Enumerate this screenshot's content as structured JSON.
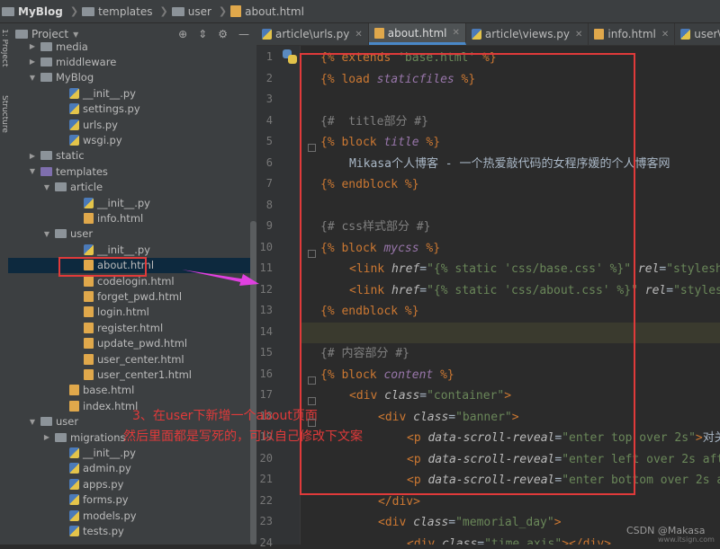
{
  "breadcrumb": [
    "MyBlog",
    "templates",
    "user",
    "about.html"
  ],
  "project_panel": {
    "label": "Project"
  },
  "left_strip_labels": [
    "1: Project",
    "Structure"
  ],
  "tree": [
    {
      "label": "media",
      "depth": 1,
      "kind": "folder",
      "arrow": "closed"
    },
    {
      "label": "middleware",
      "depth": 1,
      "kind": "folder",
      "arrow": "closed"
    },
    {
      "label": "MyBlog",
      "depth": 1,
      "kind": "pkg",
      "arrow": "open"
    },
    {
      "label": "__init__.py",
      "depth": 3,
      "kind": "py"
    },
    {
      "label": "settings.py",
      "depth": 3,
      "kind": "py"
    },
    {
      "label": "urls.py",
      "depth": 3,
      "kind": "py"
    },
    {
      "label": "wsgi.py",
      "depth": 3,
      "kind": "py"
    },
    {
      "label": "static",
      "depth": 1,
      "kind": "folder",
      "arrow": "closed"
    },
    {
      "label": "templates",
      "depth": 1,
      "kind": "tpl",
      "arrow": "open"
    },
    {
      "label": "article",
      "depth": 2,
      "kind": "folder",
      "arrow": "open"
    },
    {
      "label": "__init__.py",
      "depth": 4,
      "kind": "py"
    },
    {
      "label": "info.html",
      "depth": 4,
      "kind": "html"
    },
    {
      "label": "user",
      "depth": 2,
      "kind": "folder",
      "arrow": "open"
    },
    {
      "label": "__init__.py",
      "depth": 4,
      "kind": "py"
    },
    {
      "label": "about.html",
      "depth": 4,
      "kind": "html",
      "selected": true
    },
    {
      "label": "codelogin.html",
      "depth": 4,
      "kind": "html"
    },
    {
      "label": "forget_pwd.html",
      "depth": 4,
      "kind": "html"
    },
    {
      "label": "login.html",
      "depth": 4,
      "kind": "html"
    },
    {
      "label": "register.html",
      "depth": 4,
      "kind": "html"
    },
    {
      "label": "update_pwd.html",
      "depth": 4,
      "kind": "html"
    },
    {
      "label": "user_center.html",
      "depth": 4,
      "kind": "html"
    },
    {
      "label": "user_center1.html",
      "depth": 4,
      "kind": "html"
    },
    {
      "label": "base.html",
      "depth": 3,
      "kind": "html"
    },
    {
      "label": "index.html",
      "depth": 3,
      "kind": "html"
    },
    {
      "label": "user",
      "depth": 1,
      "kind": "pkg",
      "arrow": "open"
    },
    {
      "label": "migrations",
      "depth": 2,
      "kind": "pkg",
      "arrow": "closed"
    },
    {
      "label": "__init__.py",
      "depth": 3,
      "kind": "py"
    },
    {
      "label": "admin.py",
      "depth": 3,
      "kind": "py"
    },
    {
      "label": "apps.py",
      "depth": 3,
      "kind": "py"
    },
    {
      "label": "forms.py",
      "depth": 3,
      "kind": "py"
    },
    {
      "label": "models.py",
      "depth": 3,
      "kind": "py"
    },
    {
      "label": "tests.py",
      "depth": 3,
      "kind": "py"
    }
  ],
  "tabs": [
    {
      "label": "article\\urls.py",
      "kind": "py",
      "active": false
    },
    {
      "label": "about.html",
      "kind": "html",
      "active": true
    },
    {
      "label": "article\\views.py",
      "kind": "py",
      "active": false
    },
    {
      "label": "info.html",
      "kind": "html",
      "active": false
    },
    {
      "label": "user\\views.py",
      "kind": "py",
      "active": false
    }
  ],
  "code_lines": [
    {
      "n": 1,
      "indent": 0,
      "parts": [
        [
          "t",
          "{% extends "
        ],
        [
          "s",
          "'base.html'"
        ],
        [
          "t",
          " %}"
        ]
      ]
    },
    {
      "n": 2,
      "indent": 0,
      "parts": [
        [
          "t",
          "{% load "
        ],
        [
          "i",
          "staticfiles"
        ],
        [
          "t",
          " %}"
        ]
      ]
    },
    {
      "n": 3,
      "indent": 0,
      "parts": []
    },
    {
      "n": 4,
      "indent": 0,
      "parts": [
        [
          "c",
          "{#  title部分 #}"
        ]
      ]
    },
    {
      "n": 5,
      "indent": 0,
      "parts": [
        [
          "t",
          "{% block "
        ],
        [
          "i",
          "title"
        ],
        [
          "t",
          " %}"
        ]
      ]
    },
    {
      "n": 6,
      "indent": 1,
      "parts": [
        [
          "p",
          "Mikasa个人博客 - 一个热爱敲代码的女程序媛的个人博客网"
        ]
      ]
    },
    {
      "n": 7,
      "indent": 0,
      "parts": [
        [
          "t",
          "{% endblock "
        ],
        [
          "t",
          "%}"
        ]
      ]
    },
    {
      "n": 8,
      "indent": 0,
      "parts": []
    },
    {
      "n": 9,
      "indent": 0,
      "parts": [
        [
          "c",
          "{# css样式部分 #}"
        ]
      ]
    },
    {
      "n": 10,
      "indent": 0,
      "parts": [
        [
          "t",
          "{% block "
        ],
        [
          "i",
          "mycss"
        ],
        [
          "t",
          " %}"
        ]
      ]
    },
    {
      "n": 11,
      "indent": 1,
      "parts": [
        [
          "t",
          "<link "
        ],
        [
          "a",
          "href"
        ],
        [
          "p",
          "="
        ],
        [
          "s",
          "\"{% static 'css/base.css' %}\""
        ],
        [
          "p",
          " "
        ],
        [
          "a",
          "rel"
        ],
        [
          "p",
          "="
        ],
        [
          "s",
          "\"stylesh"
        ]
      ]
    },
    {
      "n": 12,
      "indent": 1,
      "parts": [
        [
          "t",
          "<link "
        ],
        [
          "a",
          "href"
        ],
        [
          "p",
          "="
        ],
        [
          "s",
          "\"{% static 'css/about.css' %}\""
        ],
        [
          "p",
          " "
        ],
        [
          "a",
          "rel"
        ],
        [
          "p",
          "="
        ],
        [
          "s",
          "\"styles"
        ]
      ]
    },
    {
      "n": 13,
      "indent": 0,
      "parts": [
        [
          "t",
          "{% endblock "
        ],
        [
          "t",
          "%}"
        ]
      ]
    },
    {
      "n": 14,
      "indent": 0,
      "parts": [],
      "highlight": true
    },
    {
      "n": 15,
      "indent": 0,
      "parts": [
        [
          "c",
          "{# 内容部分 #}"
        ]
      ]
    },
    {
      "n": 16,
      "indent": 0,
      "parts": [
        [
          "t",
          "{% block "
        ],
        [
          "i",
          "content"
        ],
        [
          "t",
          " %}"
        ]
      ]
    },
    {
      "n": 17,
      "indent": 1,
      "parts": [
        [
          "t",
          "<div "
        ],
        [
          "a",
          "class"
        ],
        [
          "p",
          "="
        ],
        [
          "s",
          "\"container\""
        ],
        [
          "t",
          ">"
        ]
      ]
    },
    {
      "n": 18,
      "indent": 2,
      "parts": [
        [
          "t",
          "<div "
        ],
        [
          "a",
          "class"
        ],
        [
          "p",
          "="
        ],
        [
          "s",
          "\"banner\""
        ],
        [
          "t",
          ">"
        ]
      ]
    },
    {
      "n": 19,
      "indent": 3,
      "parts": [
        [
          "t",
          "<p "
        ],
        [
          "a",
          "data-scroll-reveal"
        ],
        [
          "p",
          "="
        ],
        [
          "s",
          "\"enter top over 2s\""
        ],
        [
          "t",
          ">"
        ],
        [
          "p",
          "对关"
        ]
      ]
    },
    {
      "n": 20,
      "indent": 3,
      "parts": [
        [
          "t",
          "<p "
        ],
        [
          "a",
          "data-scroll-reveal"
        ],
        [
          "p",
          "="
        ],
        [
          "s",
          "\"enter left over 2s aft"
        ]
      ]
    },
    {
      "n": 21,
      "indent": 3,
      "parts": [
        [
          "t",
          "<p "
        ],
        [
          "a",
          "data-scroll-reveal"
        ],
        [
          "p",
          "="
        ],
        [
          "s",
          "\"enter bottom over 2s a"
        ]
      ]
    },
    {
      "n": 22,
      "indent": 2,
      "parts": [
        [
          "t",
          "</div>"
        ]
      ]
    },
    {
      "n": 23,
      "indent": 2,
      "parts": [
        [
          "t",
          "<div "
        ],
        [
          "a",
          "class"
        ],
        [
          "p",
          "="
        ],
        [
          "s",
          "\"memorial_day\""
        ],
        [
          "t",
          ">"
        ]
      ]
    },
    {
      "n": 24,
      "indent": 3,
      "parts": [
        [
          "t",
          "<div "
        ],
        [
          "a",
          "class"
        ],
        [
          "p",
          "="
        ],
        [
          "s",
          "\"time_axis\""
        ],
        [
          "t",
          "></div>"
        ]
      ]
    }
  ],
  "annotation": {
    "line1": "3、在user下新增一个about页面",
    "line2": "然后里面都是写死的，可以自己修改下文案"
  },
  "watermark": {
    "main": "CSDN @Makasa",
    "sub": "www.itsign.com"
  },
  "colors": {
    "annotation": "#e03a3a",
    "selection": "#0d293e",
    "arrow": "#e040e0"
  }
}
